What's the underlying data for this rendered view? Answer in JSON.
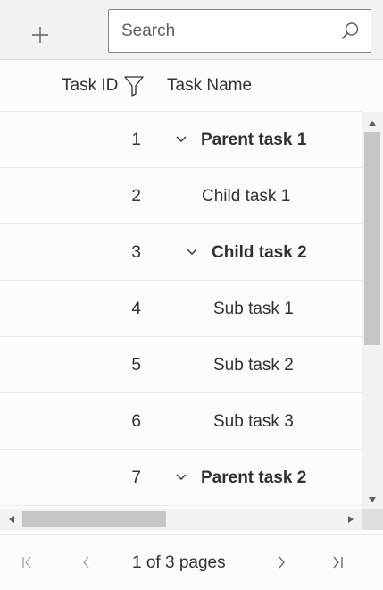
{
  "toolbar": {
    "add_icon": "plus-icon",
    "search": {
      "placeholder": "Search",
      "value": "",
      "icon": "search-icon"
    }
  },
  "header": {
    "task_id": "Task ID",
    "task_name": "Task Name",
    "filter_icon": "filter-icon"
  },
  "rows": [
    {
      "id": "1",
      "name": "Parent task 1",
      "bold": true,
      "expandable": true,
      "level": 0
    },
    {
      "id": "2",
      "name": "Child task 1",
      "bold": false,
      "expandable": false,
      "level": 1
    },
    {
      "id": "3",
      "name": "Child task 2",
      "bold": true,
      "expandable": true,
      "level": 1
    },
    {
      "id": "4",
      "name": "Sub task 1",
      "bold": false,
      "expandable": false,
      "level": 2
    },
    {
      "id": "5",
      "name": "Sub task 2",
      "bold": false,
      "expandable": false,
      "level": 2
    },
    {
      "id": "6",
      "name": "Sub task 3",
      "bold": false,
      "expandable": false,
      "level": 2
    },
    {
      "id": "7",
      "name": "Parent task 2",
      "bold": true,
      "expandable": true,
      "level": 0
    }
  ],
  "pager": {
    "text": "1 of 3 pages",
    "icons": [
      "first-page-icon",
      "previous-page-icon",
      "next-page-icon",
      "last-page-icon"
    ]
  },
  "colors": {
    "toolbar_bg": "#f3f2f1",
    "grid_bg": "#fdfcfb",
    "border": "#edebe9",
    "scroll_thumb": "#c8c6c4",
    "text": "#323130"
  }
}
